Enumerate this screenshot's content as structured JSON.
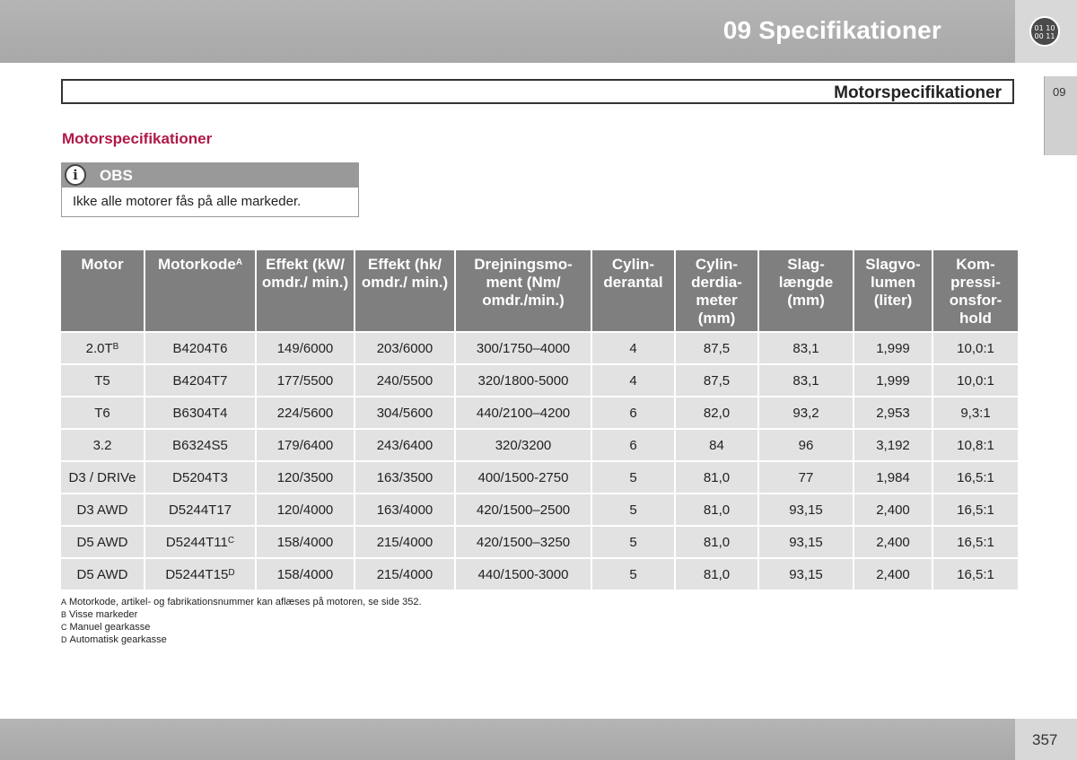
{
  "header": {
    "chapter_title": "09 Specifikationer",
    "icon_text_top": "01 10",
    "icon_text_bottom": "00 11",
    "section_title": "Motorspecifikationer",
    "side_tab": "09"
  },
  "subtitle": "Motorspecifikationer",
  "note": {
    "label": "OBS",
    "icon": "info-icon",
    "text": "Ikke alle motorer fås på alle markeder."
  },
  "table": {
    "columns": [
      {
        "text": "Motor",
        "sup": ""
      },
      {
        "text": "Motorkode",
        "sup": "A"
      },
      {
        "text": "Effekt (kW/ omdr./ min.)",
        "sup": ""
      },
      {
        "text": "Effekt (hk/ omdr./ min.)",
        "sup": ""
      },
      {
        "text": "Drejningsmo- ment (Nm/ omdr./min.)",
        "sup": ""
      },
      {
        "text": "Cylin- derantal",
        "sup": ""
      },
      {
        "text": "Cylin- derdia- meter (mm)",
        "sup": ""
      },
      {
        "text": "Slag- længde (mm)",
        "sup": ""
      },
      {
        "text": "Slagvo- lumen (liter)",
        "sup": ""
      },
      {
        "text": "Kom- pressi- onsfor- hold",
        "sup": ""
      }
    ],
    "rows": [
      {
        "motor": "2.0T",
        "motor_sup": "B",
        "code": "B4204T6",
        "code_sup": "",
        "kw": "149/6000",
        "hk": "203/6000",
        "nm": "300/1750–4000",
        "cyl": "4",
        "dia": "87,5",
        "stroke": "83,1",
        "vol": "1,999",
        "comp": "10,0:1"
      },
      {
        "motor": "T5",
        "motor_sup": "",
        "code": "B4204T7",
        "code_sup": "",
        "kw": "177/5500",
        "hk": "240/5500",
        "nm": "320/1800-5000",
        "cyl": "4",
        "dia": "87,5",
        "stroke": "83,1",
        "vol": "1,999",
        "comp": "10,0:1"
      },
      {
        "motor": "T6",
        "motor_sup": "",
        "code": "B6304T4",
        "code_sup": "",
        "kw": "224/5600",
        "hk": "304/5600",
        "nm": "440/2100–4200",
        "cyl": "6",
        "dia": "82,0",
        "stroke": "93,2",
        "vol": "2,953",
        "comp": "9,3:1"
      },
      {
        "motor": "3.2",
        "motor_sup": "",
        "code": "B6324S5",
        "code_sup": "",
        "kw": "179/6400",
        "hk": "243/6400",
        "nm": "320/3200",
        "cyl": "6",
        "dia": "84",
        "stroke": "96",
        "vol": "3,192",
        "comp": "10,8:1"
      },
      {
        "motor": "D3 / DRIVe",
        "motor_sup": "",
        "code": "D5204T3",
        "code_sup": "",
        "kw": "120/3500",
        "hk": "163/3500",
        "nm": "400/1500-2750",
        "cyl": "5",
        "dia": "81,0",
        "stroke": "77",
        "vol": "1,984",
        "comp": "16,5:1"
      },
      {
        "motor": "D3 AWD",
        "motor_sup": "",
        "code": "D5244T17",
        "code_sup": "",
        "kw": "120/4000",
        "hk": "163/4000",
        "nm": "420/1500–2500",
        "cyl": "5",
        "dia": "81,0",
        "stroke": "93,15",
        "vol": "2,400",
        "comp": "16,5:1"
      },
      {
        "motor": "D5 AWD",
        "motor_sup": "",
        "code": "D5244T11",
        "code_sup": "C",
        "kw": "158/4000",
        "hk": "215/4000",
        "nm": "420/1500–3250",
        "cyl": "5",
        "dia": "81,0",
        "stroke": "93,15",
        "vol": "2,400",
        "comp": "16,5:1"
      },
      {
        "motor": "D5 AWD",
        "motor_sup": "",
        "code": "D5244T15",
        "code_sup": "D",
        "kw": "158/4000",
        "hk": "215/4000",
        "nm": "440/1500-3000",
        "cyl": "5",
        "dia": "81,0",
        "stroke": "93,15",
        "vol": "2,400",
        "comp": "16,5:1"
      }
    ]
  },
  "footnotes": [
    {
      "letter": "A",
      "text": "Motorkode, artikel- og fabrikationsnummer kan aflæses på motoren, se side 352."
    },
    {
      "letter": "B",
      "text": "Visse markeder"
    },
    {
      "letter": "C",
      "text": "Manuel gearkasse"
    },
    {
      "letter": "D",
      "text": "Automatisk gearkasse"
    }
  ],
  "page_number": "357"
}
